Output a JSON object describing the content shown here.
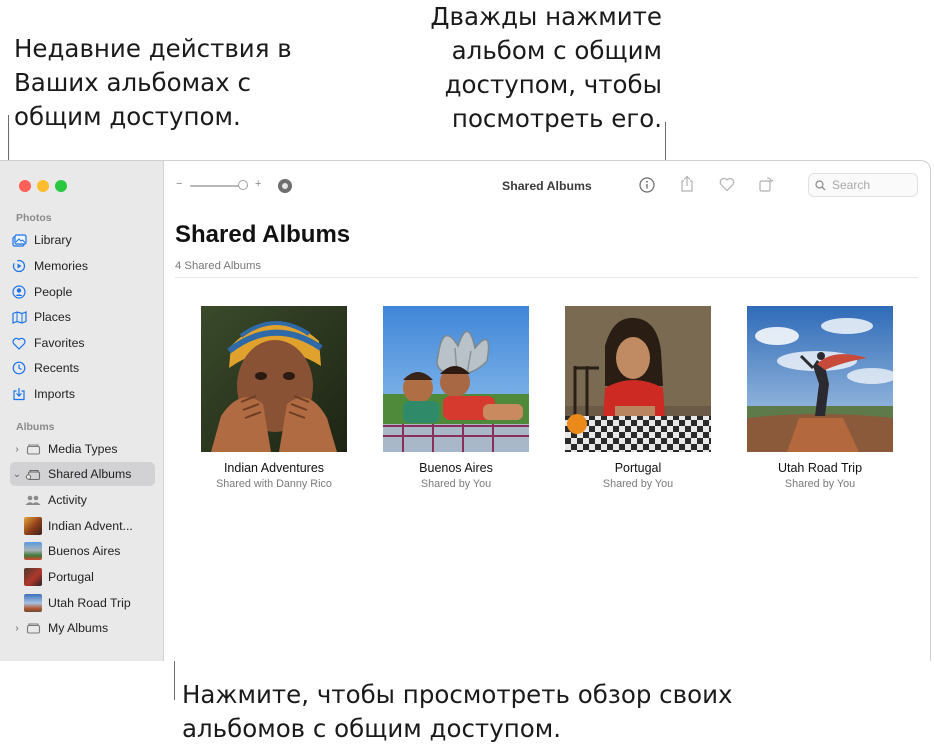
{
  "annotations": {
    "left": "Недавние действия в Ваших альбомах с общим доступом.",
    "right": "Дважды нажмите альбом с общим доступом, чтобы посмотреть его.",
    "bottom": "Нажмите, чтобы просмотреть обзор своих альбомов с общим доступом."
  },
  "sidebar": {
    "photos_header": "Photos",
    "photos_items": [
      {
        "label": "Library",
        "icon": "library-icon"
      },
      {
        "label": "Memories",
        "icon": "memories-icon"
      },
      {
        "label": "People",
        "icon": "people-icon"
      },
      {
        "label": "Places",
        "icon": "places-icon"
      },
      {
        "label": "Favorites",
        "icon": "heart-icon"
      },
      {
        "label": "Recents",
        "icon": "clock-icon"
      },
      {
        "label": "Imports",
        "icon": "import-icon"
      }
    ],
    "albums_header": "Albums",
    "media_types": "Media Types",
    "shared_albums": "Shared Albums",
    "activity": "Activity",
    "shared_children": [
      "Indian Advent...",
      "Buenos Aires",
      "Portugal",
      "Utah Road Trip"
    ],
    "my_albums": "My Albums"
  },
  "toolbar": {
    "title": "Shared Albums",
    "zoom_minus": "−",
    "zoom_plus": "+",
    "search_placeholder": "Search"
  },
  "content": {
    "title": "Shared Albums",
    "subtitle": "4 Shared Albums",
    "albums": [
      {
        "name": "Indian Adventures",
        "subtitle": "Shared with Danny Rico"
      },
      {
        "name": "Buenos Aires",
        "subtitle": "Shared by You"
      },
      {
        "name": "Portugal",
        "subtitle": "Shared by You"
      },
      {
        "name": "Utah Road Trip",
        "subtitle": "Shared by You"
      }
    ]
  },
  "colors": {
    "accent": "#1a73e8",
    "close": "#fe5f57",
    "minimize": "#febc2e",
    "zoom": "#28c840"
  }
}
